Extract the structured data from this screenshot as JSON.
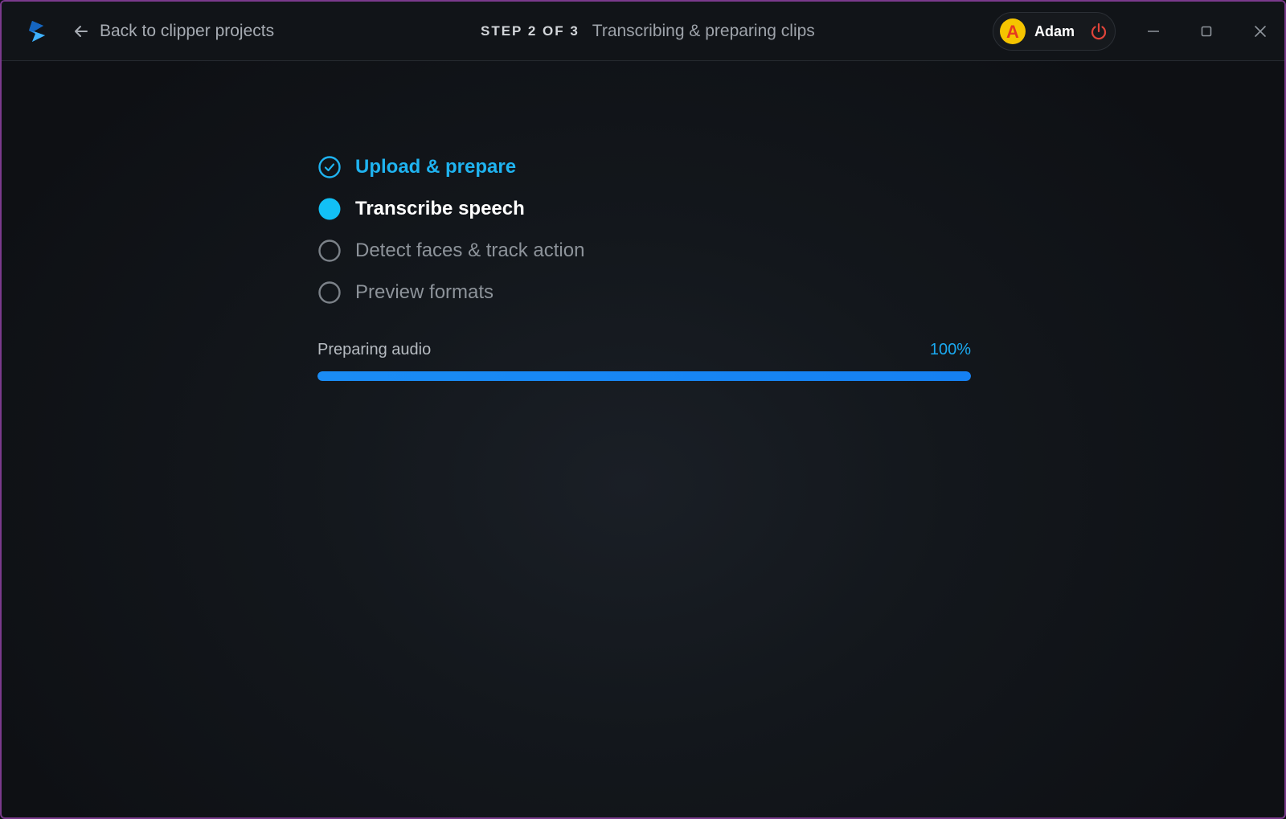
{
  "titlebar": {
    "back_label": "Back to clipper projects",
    "step_counter": "STEP 2 OF 3",
    "step_title": "Transcribing & preparing clips",
    "user_name": "Adam",
    "avatar_letter": "A"
  },
  "steps": [
    {
      "label": "Upload & prepare",
      "state": "done"
    },
    {
      "label": "Transcribe speech",
      "state": "active"
    },
    {
      "label": "Detect faces & track action",
      "state": "pending"
    },
    {
      "label": "Preview formats",
      "state": "pending"
    }
  ],
  "progress": {
    "label": "Preparing audio",
    "value_text": "100%",
    "fraction": 1.0
  },
  "colors": {
    "accent": "#1fb3f0",
    "progress": "#1580f2",
    "window_border": "#7a3a8c",
    "power": "#e0443a"
  }
}
